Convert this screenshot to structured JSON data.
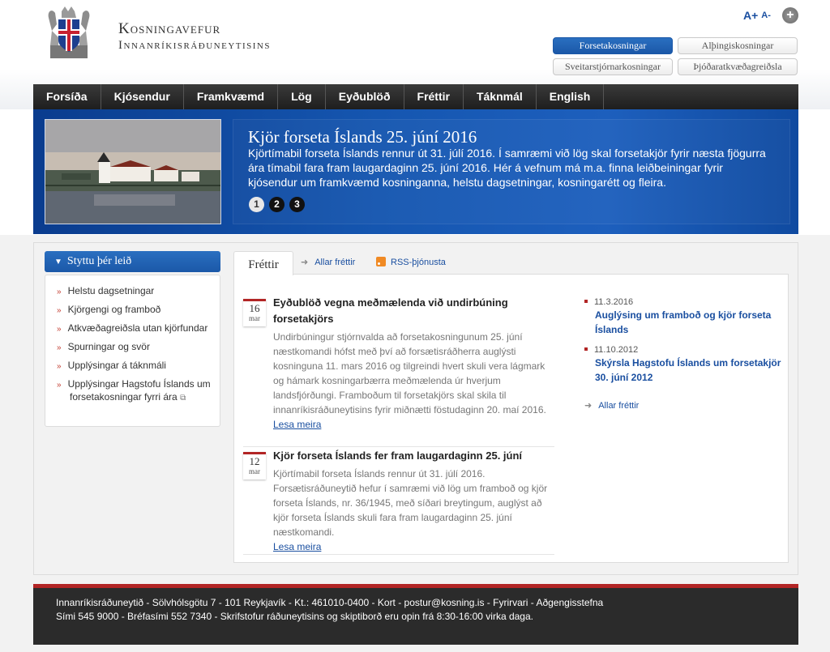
{
  "header": {
    "title_line1": "Kosningavefur",
    "title_line2": "Innanríkisráðuneytisins",
    "font_larger": "A+",
    "font_smaller": "A-",
    "plus_icon": "+",
    "election_tabs": [
      "Forsetakosningar",
      "Alþingiskosningar",
      "Sveitarstjórnarkosningar",
      "Þjóðaratkvæðagreiðsla"
    ],
    "active_tab": "Forsetakosningar"
  },
  "nav": {
    "items": [
      "Forsíða",
      "Kjósendur",
      "Framkvæmd",
      "Lög",
      "Eyðublöð",
      "Fréttir",
      "Táknmál",
      "English"
    ]
  },
  "banner": {
    "title": "Kjör forseta Íslands 25. júní 2016",
    "description": "Kjörtímabil forseta Íslands rennur út 31. júlí 2016. Í samræmi við lög skal forsetakjör fyrir næsta fjögurra ára tímabil fara fram laugardaginn 25. júní 2016. Hér á vefnum má m.a. finna leiðbeiningar fyrir kjósendur um framkvæmd kosninganna, helstu dagsetningar, kosningarétt og fleira.",
    "dots": [
      "1",
      "2",
      "3"
    ],
    "active_dot": "1"
  },
  "sidebar": {
    "heading": "Styttu þér leið",
    "items": [
      "Helstu dagsetningar",
      "Kjörgengi og framboð",
      "Atkvæðagreiðsla utan kjörfundar",
      "Spurningar og svör",
      "Upplýsingar á táknmáli",
      "Upplýsingar Hagstofu Íslands um forsetakosningar fyrri ára"
    ]
  },
  "news": {
    "tab_label": "Fréttir",
    "all_news": "Allar fréttir",
    "rss": "RSS-þjónusta",
    "articles": [
      {
        "day": "16",
        "month": "mar",
        "title": "Eyðublöð vegna meðmælenda við undirbúning forsetakjörs",
        "body": "Undirbúningur stjórnvalda að forsetakosningunum 25. júní næstkomandi hófst með því að forsætisráðherra auglýsti kosninguna 11. mars 2016 og tilgreindi hvert skuli vera lágmark og hámark kosningarbærra meðmælenda úr hverjum landsfjórðungi. Framboðum til forsetakjörs skal skila til innanríkisráðuneytisins fyrir miðnætti föstudaginn 20. maí 2016.",
        "more": "Lesa meira"
      },
      {
        "day": "12",
        "month": "mar",
        "title": "Kjör forseta Íslands fer fram laugardaginn 25. júní",
        "body": "Kjörtímabil forseta Íslands rennur út 31. júlí 2016. Forsætisráðuneytið hefur í samræmi við lög um framboð og kjör forseta Íslands, nr. 36/1945, með síðari breytingum, auglýst að kjör forseta Íslands skuli fara fram laugardaginn 25. júní næstkomandi.",
        "more": "Lesa meira"
      }
    ],
    "side_items": [
      {
        "date": "11.3.2016",
        "title": "Auglýsing um framboð og kjör forseta Íslands"
      },
      {
        "date": "11.10.2012",
        "title": "Skýrsla Hagstofu Íslands um forsetakjör 30. júní 2012"
      }
    ],
    "side_all_news": "Allar fréttir"
  },
  "footer": {
    "line1": "Innanríkisráðuneytið - Sölvhólsgötu 7 - 101 Reykjavík - Kt.: 461010-0400 - Kort - postur@kosning.is - Fyrirvari - Aðgengisstefna",
    "line2": "Sími 545 9000 - Bréfasími 552 7340 - Skrifstofur ráðuneytisins og skiptiborð eru opin frá 8:30-16:00 virka daga."
  },
  "colors": {
    "accent_blue": "#1b58a8",
    "nav_dark": "#2b2b2b",
    "red": "#b22525"
  }
}
